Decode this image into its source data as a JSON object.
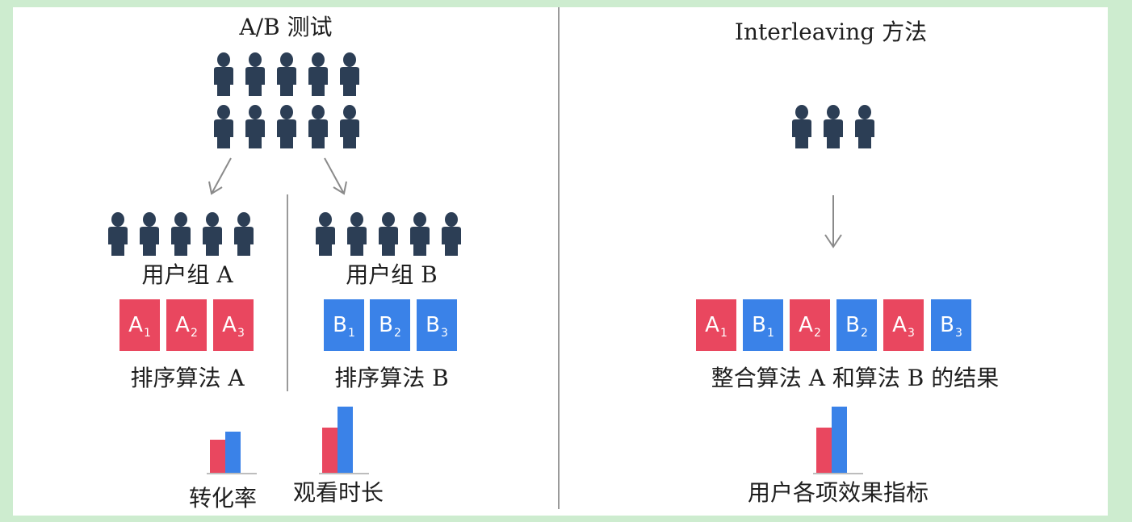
{
  "left_panel": {
    "title": "A/B 测试",
    "group_a": {
      "label": "用户组 A",
      "cards": [
        {
          "letter": "A",
          "index": "1"
        },
        {
          "letter": "A",
          "index": "2"
        },
        {
          "letter": "A",
          "index": "3"
        }
      ],
      "algorithm": "排序算法 A"
    },
    "group_b": {
      "label": "用户组 B",
      "cards": [
        {
          "letter": "B",
          "index": "1"
        },
        {
          "letter": "B",
          "index": "2"
        },
        {
          "letter": "B",
          "index": "3"
        }
      ],
      "algorithm": "排序算法 B"
    },
    "metric_1": "转化率",
    "metric_2": "观看时长"
  },
  "right_panel": {
    "title": "Interleaving 方法",
    "cards": [
      {
        "letter": "A",
        "index": "1"
      },
      {
        "letter": "B",
        "index": "1"
      },
      {
        "letter": "A",
        "index": "2"
      },
      {
        "letter": "B",
        "index": "2"
      },
      {
        "letter": "A",
        "index": "3"
      },
      {
        "letter": "B",
        "index": "3"
      }
    ],
    "result": "整合算法 A 和算法 B 的结果",
    "metrics": "用户各项效果指标"
  },
  "colors": {
    "background": "#cdeccf",
    "algorithm_a": "#e9475f",
    "algorithm_b": "#3a82e8",
    "person": "#2c3e55"
  },
  "icons": {
    "user": "person-icon",
    "flow": "arrow-down-icon"
  }
}
